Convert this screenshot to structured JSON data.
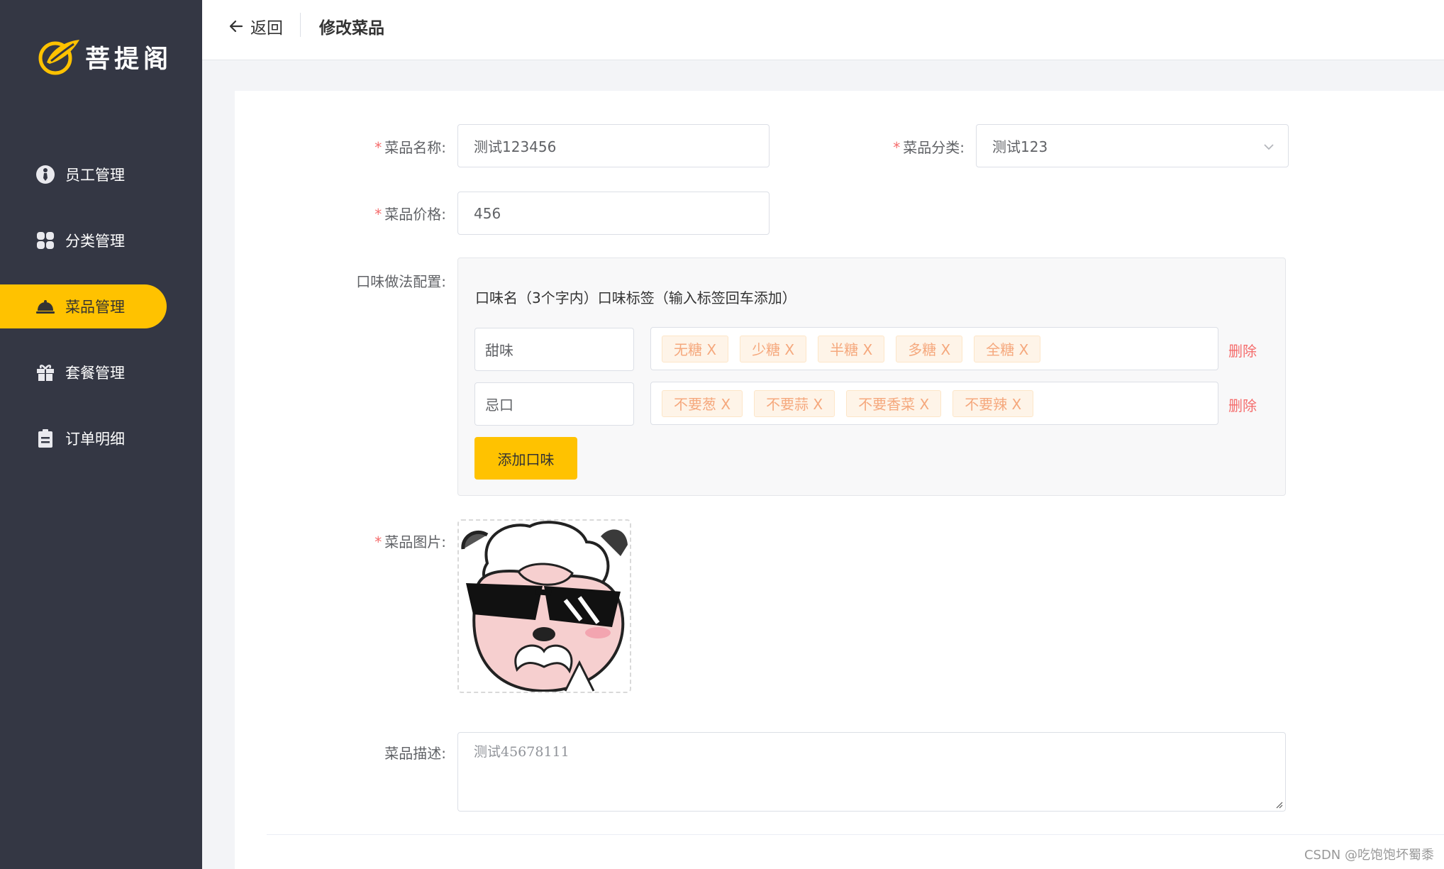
{
  "brand": {
    "name": "菩提阁",
    "accent": "#ffc200",
    "sidebar_bg": "#343744"
  },
  "sidebar": {
    "items": [
      {
        "label": "员工管理",
        "icon": "employee-icon",
        "active": false
      },
      {
        "label": "分类管理",
        "icon": "category-grid-icon",
        "active": false
      },
      {
        "label": "菜品管理",
        "icon": "dish-cloche-icon",
        "active": true
      },
      {
        "label": "套餐管理",
        "icon": "gift-box-icon",
        "active": false
      },
      {
        "label": "订单明细",
        "icon": "clipboard-icon",
        "active": false
      }
    ]
  },
  "header": {
    "back_label": "返回",
    "title": "修改菜品"
  },
  "form": {
    "name": {
      "label": "菜品名称:",
      "value": "测试123456"
    },
    "category": {
      "label": "菜品分类:",
      "value": "测试123"
    },
    "price": {
      "label": "菜品价格:",
      "value": "456"
    },
    "flavor": {
      "label": "口味做法配置:",
      "header": "口味名（3个字内）口味标签（输入标签回车添加）",
      "rows": [
        {
          "name": "甜味",
          "tags": [
            "无糖 X",
            "少糖 X",
            "半糖 X",
            "多糖 X",
            "全糖 X"
          ],
          "delete_label": "删除"
        },
        {
          "name": "忌口",
          "tags": [
            "不要葱 X",
            "不要蒜 X",
            "不要香菜 X",
            "不要辣 X"
          ],
          "delete_label": "删除"
        }
      ],
      "add_label": "添加口味"
    },
    "image": {
      "label": "菜品图片:"
    },
    "description": {
      "label": "菜品描述:",
      "value": "测试45678111"
    }
  },
  "watermark": "CSDN @吃饱饱坏蜀黍"
}
